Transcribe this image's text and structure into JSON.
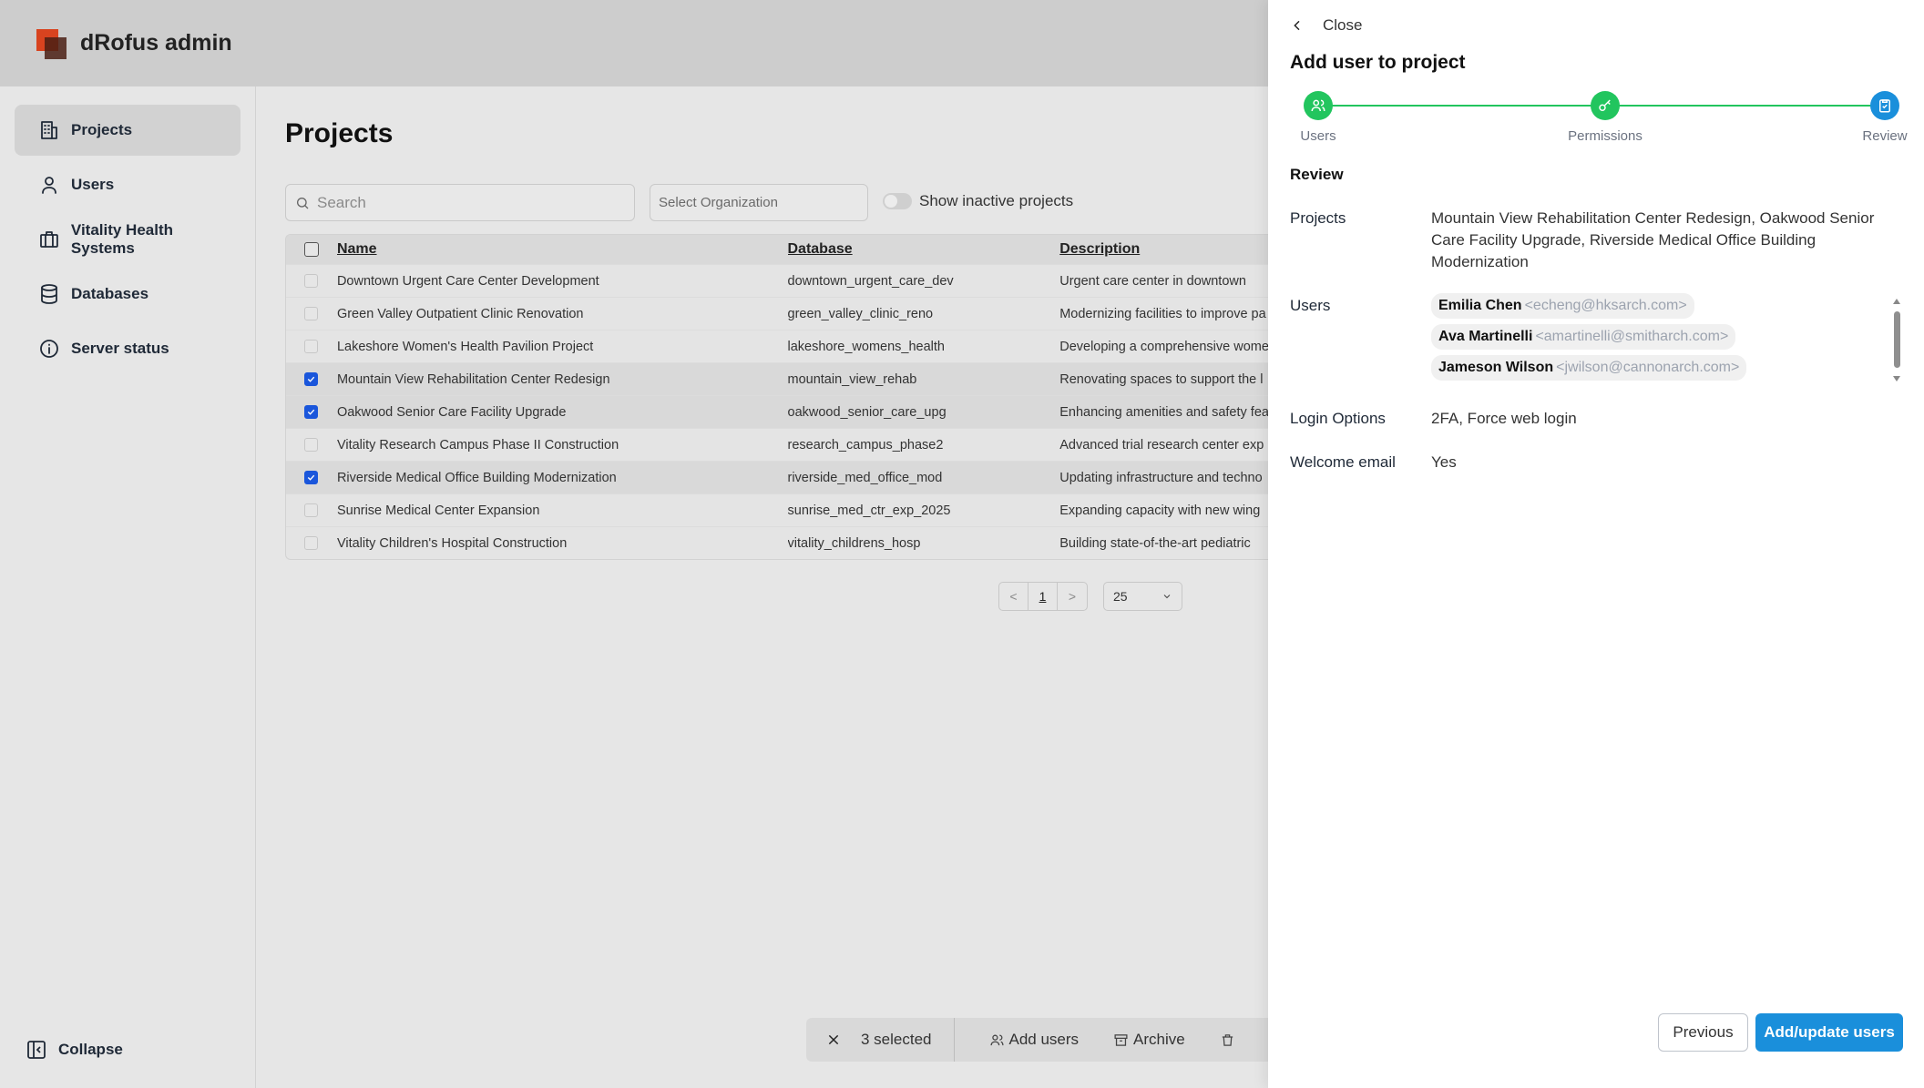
{
  "app": {
    "title": "dRofus admin"
  },
  "sidebar": {
    "items": [
      {
        "label": "Projects",
        "icon": "building-icon",
        "active": true
      },
      {
        "label": "Users",
        "icon": "user-icon",
        "active": false
      },
      {
        "label": "Vitality Health Systems",
        "icon": "briefcase-icon",
        "active": false
      },
      {
        "label": "Databases",
        "icon": "database-icon",
        "active": false
      },
      {
        "label": "Server status",
        "icon": "info-icon",
        "active": false
      }
    ],
    "collapse_label": "Collapse"
  },
  "main": {
    "title": "Projects",
    "search_placeholder": "Search",
    "org_placeholder": "Select Organization",
    "inactive_toggle_label": "Show inactive projects",
    "table": {
      "columns": [
        "Name",
        "Database",
        "Description"
      ],
      "rows": [
        {
          "name": "Downtown Urgent Care Center Development",
          "db": "downtown_urgent_care_dev",
          "desc": "Urgent care center in downtown",
          "checked": false
        },
        {
          "name": "Green Valley Outpatient Clinic Renovation",
          "db": "green_valley_clinic_reno",
          "desc": "Modernizing facilities to improve pa",
          "checked": false
        },
        {
          "name": "Lakeshore Women's Health Pavilion Project",
          "db": "lakeshore_womens_health",
          "desc": "Developing a comprehensive wome",
          "checked": false
        },
        {
          "name": "Mountain View Rehabilitation Center Redesign",
          "db": "mountain_view_rehab",
          "desc": "Renovating spaces to support the l",
          "checked": true
        },
        {
          "name": "Oakwood Senior Care Facility Upgrade",
          "db": "oakwood_senior_care_upg",
          "desc": "Enhancing amenities and safety fea",
          "checked": true
        },
        {
          "name": "Vitality Research Campus Phase II Construction",
          "db": "research_campus_phase2",
          "desc": "Advanced trial research center exp",
          "checked": false
        },
        {
          "name": "Riverside Medical Office Building Modernization",
          "db": "riverside_med_office_mod",
          "desc": "Updating infrastructure and techno",
          "checked": true
        },
        {
          "name": "Sunrise Medical Center Expansion",
          "db": "sunrise_med_ctr_exp_2025",
          "desc": "Expanding capacity with new wing",
          "checked": false
        },
        {
          "name": "Vitality Children's Hospital Construction",
          "db": "vitality_childrens_hosp",
          "desc": "Building state-of-the-art pediatric",
          "checked": false
        }
      ]
    },
    "pagination": {
      "prev": "<",
      "page": "1",
      "next": ">",
      "page_size": "25"
    },
    "action_bar": {
      "selected_text": "3 selected",
      "add_users": "Add users",
      "archive": "Archive"
    }
  },
  "drawer": {
    "close_label": "Close",
    "title": "Add user to project",
    "steps": [
      {
        "label": "Users",
        "icon": "users-icon",
        "done": true
      },
      {
        "label": "Permissions",
        "icon": "key-icon",
        "done": true
      },
      {
        "label": "Review",
        "icon": "clipboard-check-icon",
        "current": true
      }
    ],
    "section_title": "Review",
    "projects_label": "Projects",
    "projects_value": "Mountain View Rehabilitation Center Redesign, Oakwood Senior Care Facility Upgrade, Riverside Medical Office Building Modernization",
    "users_label": "Users",
    "users": [
      {
        "name": "Emilia Chen",
        "email": "<echeng@hksarch.com>"
      },
      {
        "name": "Ava Martinelli",
        "email": "<amartinelli@smitharch.com>"
      },
      {
        "name": "Jameson Wilson",
        "email": "<jwilson@cannonarch.com>"
      }
    ],
    "login_label": "Login Options",
    "login_value": "2FA, Force web login",
    "welcome_label": "Welcome email",
    "welcome_value": "Yes",
    "prev_button": "Previous",
    "submit_button": "Add/update users"
  },
  "colors": {
    "accent": "#1a8fdb",
    "step_done": "#22c55e",
    "check": "#1a56db"
  }
}
